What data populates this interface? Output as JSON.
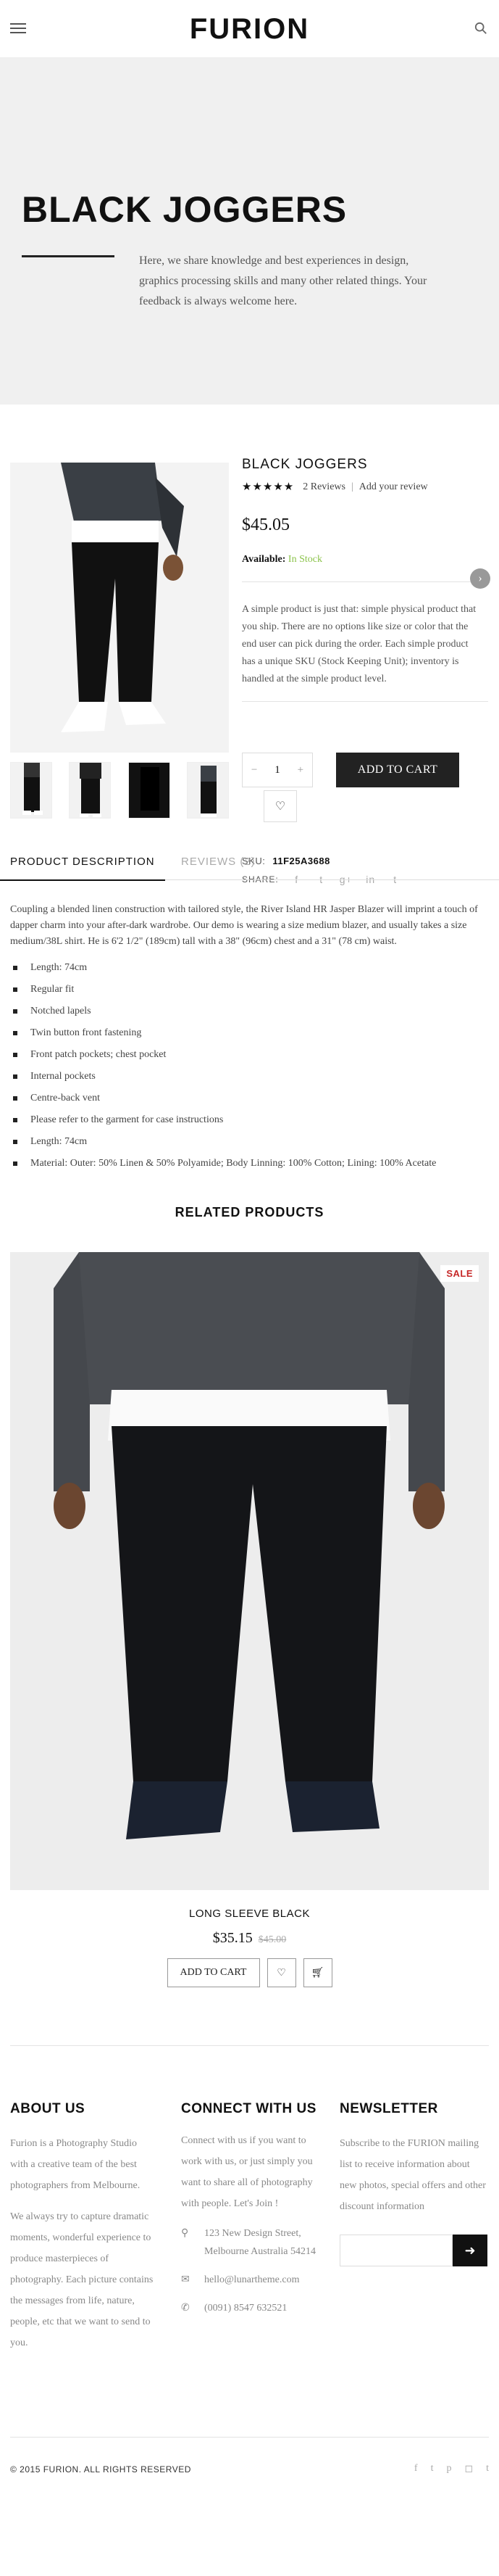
{
  "brand": {
    "logo": "FURION"
  },
  "hero": {
    "title": "BLACK JOGGERS",
    "text": "Here, we share knowledge and best experiences in design, graphics processing skills and many other related things. Your feedback is always welcome here."
  },
  "product": {
    "title": "BLACK JOGGERS",
    "stars": "★★★★★",
    "reviews": "2 Reviews",
    "add_review": "Add your review",
    "price": "$45.05",
    "availability_label": "Available:",
    "availability_value": "In Stock",
    "description": "A simple product is just that: simple physical product that you ship. There are no options like size or color that the end user can pick during the order. Each simple product has a unique SKU (Stock Keeping Unit); inventory is handled at the simple product level.",
    "qty_minus": "−",
    "qty_value": "1",
    "qty_plus": "+",
    "add_to_cart": "ADD TO CART",
    "sku_label": "SKU:",
    "sku_value": "11F25A3688",
    "share_label": "SHARE:"
  },
  "tabs": {
    "description": "PRODUCT DESCRIPTION",
    "reviews": "REVIEWS (2)"
  },
  "details": {
    "paragraph": "Coupling a blended linen construction with tailored style, the River Island HR Jasper Blazer will imprint a touch of dapper charm into your after-dark wardrobe. Our demo is wearing a size medium blazer, and usually takes a size medium/38L shirt. He is 6'2 1/2\" (189cm) tall with a 38\" (96cm) chest and a 31\" (78 cm) waist.",
    "bullets": [
      "Length: 74cm",
      "Regular fit",
      "Notched lapels",
      "Twin button front fastening",
      "Front patch pockets; chest pocket",
      "Internal pockets",
      "Centre-back vent",
      "Please refer to the garment for case instructions",
      "Length: 74cm",
      "Material: Outer: 50% Linen & 50% Polyamide; Body Linning: 100% Cotton; Lining: 100% Acetate"
    ]
  },
  "related": {
    "heading": "RELATED PRODUCTS",
    "badge": "SALE",
    "name": "LONG SLEEVE BLACK",
    "price": "$35.15",
    "old_price": "$45.00",
    "add_to_cart": "ADD TO CART"
  },
  "footer": {
    "about_title": "ABOUT US",
    "about_p1": "Furion is a Photography Studio with a creative team of the best photographers from Melbourne.",
    "about_p2": "We always try to capture dramatic moments, wonderful experience to produce masterpieces of photography. Each picture contains the messages from life, nature, people, etc that we want to send to you.",
    "connect_title": "CONNECT WITH US",
    "connect_text": "Connect with us if you want to work with us, or just simply you want to share all of photography with people. Let's Join !",
    "address": "123 New Design Street, Melbourne Australia 54214",
    "email": "hello@lunartheme.com",
    "phone": "(0091) 8547 632521",
    "newsletter_title": "NEWSLETTER",
    "newsletter_text": "Subscribe to the FURION mailing list to receive information about new photos, special offers and other discount information",
    "copyright": "© 2015 FURION. ALL RIGHTS RESERVED"
  },
  "colors": {
    "accent": "#111111",
    "in_stock": "#8bc34a",
    "sale": "#c62828",
    "hero_bg": "#f0f0f0"
  }
}
